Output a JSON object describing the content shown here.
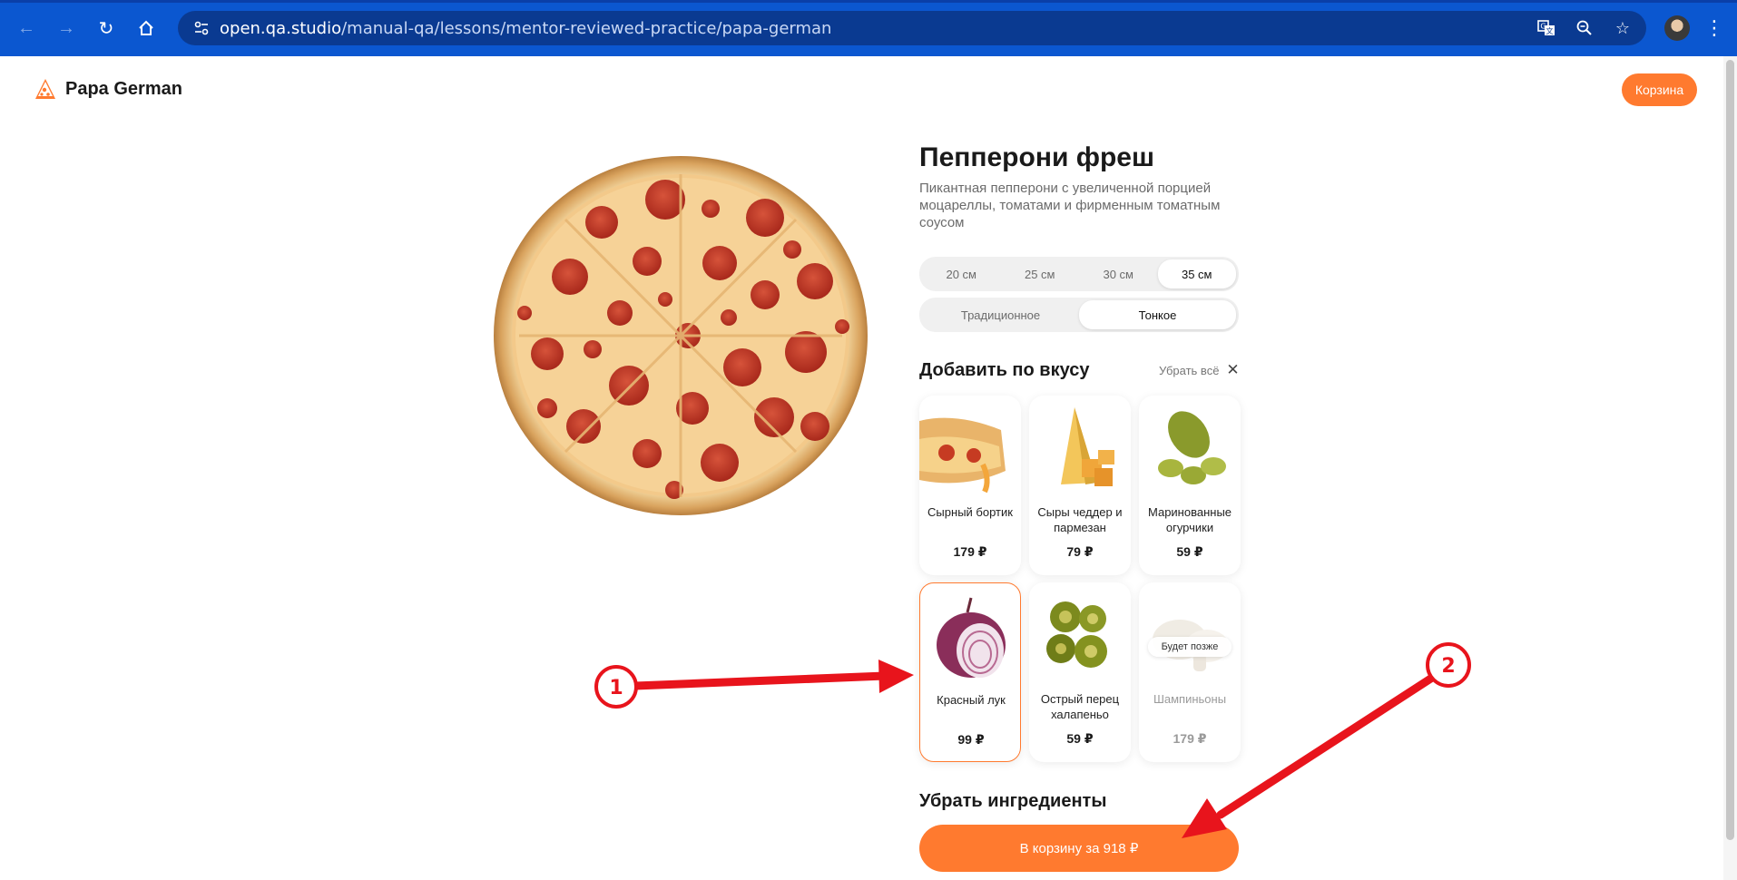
{
  "browser": {
    "url_host": "open.qa.studio",
    "url_path": "/manual-qa/lessons/mentor-reviewed-practice/papa-german",
    "icons": [
      "back-icon",
      "forward-icon",
      "reload-icon",
      "home-icon",
      "site-info-icon",
      "translate-icon",
      "zoom-icon",
      "bookmark-star-icon",
      "menu-icon"
    ]
  },
  "header": {
    "brand": "Papa German",
    "cart_label": "Корзина"
  },
  "product": {
    "title": "Пепперони фреш",
    "description": "Пикантная пепперони с увеличенной порцией моцареллы, томатами и фирменным томатным соусом",
    "sizes": [
      {
        "label": "20 см",
        "active": false
      },
      {
        "label": "25 см",
        "active": false
      },
      {
        "label": "30 см",
        "active": false
      },
      {
        "label": "35 см",
        "active": true
      }
    ],
    "dough": [
      {
        "label": "Традиционное",
        "active": false
      },
      {
        "label": "Тонкое",
        "active": true
      }
    ]
  },
  "toppings": {
    "heading": "Добавить по вкусу",
    "clear_label": "Убрать всё",
    "items": [
      {
        "name": "Сырный бортик",
        "price": "179 ₽",
        "selected": false,
        "disabled": false
      },
      {
        "name": "Сыры чеддер и пармезан",
        "price": "79 ₽",
        "selected": false,
        "disabled": false
      },
      {
        "name": "Маринованные огурчики",
        "price": "59 ₽",
        "selected": false,
        "disabled": false
      },
      {
        "name": "Красный лук",
        "price": "99 ₽",
        "selected": true,
        "disabled": false
      },
      {
        "name": "Острый перец халапеньо",
        "price": "59 ₽",
        "selected": false,
        "disabled": false
      },
      {
        "name": "Шампиньоны",
        "price": "179 ₽",
        "selected": false,
        "disabled": true,
        "badge": "Будет позже"
      }
    ]
  },
  "remove_section": {
    "heading": "Убрать ингредиенты"
  },
  "cta": {
    "label": "В корзину за 918 ₽"
  },
  "annotations": [
    {
      "number": "1",
      "target": "Красный лук"
    },
    {
      "number": "2",
      "target": "В корзину за 918 ₽"
    }
  ],
  "colors": {
    "browser_chrome": "#0b57d0",
    "accent": "#ff7a2f",
    "annotation_red": "#e8141c"
  }
}
